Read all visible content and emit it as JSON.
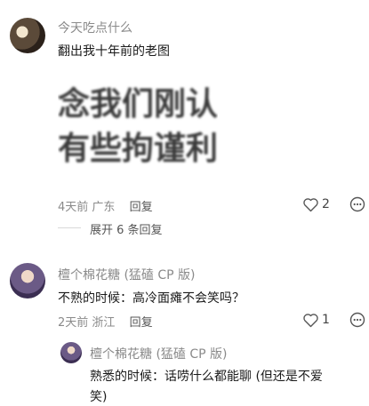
{
  "comment1": {
    "name": "今天吃点什么",
    "text": "翻出我十年前的老图",
    "image_line1": "念我们刚认",
    "image_line2": "有些拘谨利",
    "time": "4天前",
    "location": "广东",
    "reply_label": "回复",
    "likes": "2",
    "expand_label": "展开 6 条回复"
  },
  "comment2": {
    "name": "檀个棉花糖 (猛磕 CP 版)",
    "text": "不熟的时候：高冷面瘫不会笑吗？",
    "time": "2天前",
    "location": "浙江",
    "reply_label": "回复",
    "likes": "1"
  },
  "reply1": {
    "name": "檀个棉花糖 (猛磕 CP 版)",
    "text_line1": "熟悉的时候：话唠什么都能聊 (但还是不爱",
    "text_line2": "笑)"
  }
}
